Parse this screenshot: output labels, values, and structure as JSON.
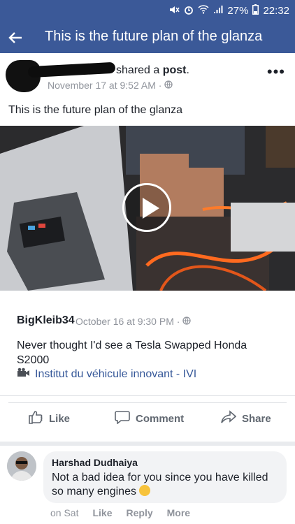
{
  "status": {
    "battery": "27%",
    "time": "22:32"
  },
  "appbar": {
    "title": "This is the future plan of the glanza"
  },
  "post": {
    "shared_prefix": "shared a ",
    "shared_bold": "post",
    "shared_suffix": ".",
    "date": "November 17 at 9:52 AM ·",
    "text": "This is the future plan of the glanza"
  },
  "shared_post": {
    "author": "BigKleib34",
    "date": "October 16 at 9:30 PM ·",
    "text": "Never thought I'd see a Tesla Swapped Honda S2000",
    "link": "Institut du véhicule innovant - IVI"
  },
  "actions": {
    "like": "Like",
    "comment": "Comment",
    "share": "Share"
  },
  "comment": {
    "author": "Harshad Dudhaiya",
    "text": "Not a bad idea for you since you have killed so many engines",
    "time": "on Sat",
    "like": "Like",
    "reply": "Reply",
    "more": "More"
  },
  "colors": {
    "brand": "#3b5998",
    "link": "#365899"
  }
}
